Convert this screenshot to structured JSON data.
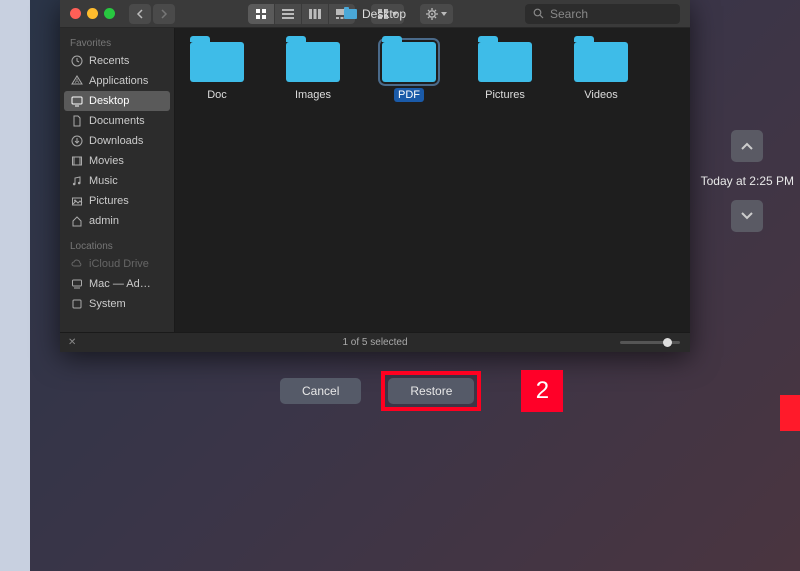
{
  "window": {
    "title": "Desktop"
  },
  "search": {
    "placeholder": "Search"
  },
  "sidebar": {
    "sections": [
      {
        "header": "Favorites",
        "items": [
          {
            "label": "Recents",
            "icon": "clock-icon"
          },
          {
            "label": "Applications",
            "icon": "apps-icon"
          },
          {
            "label": "Desktop",
            "icon": "desktop-icon",
            "selected": true
          },
          {
            "label": "Documents",
            "icon": "documents-icon"
          },
          {
            "label": "Downloads",
            "icon": "downloads-icon"
          },
          {
            "label": "Movies",
            "icon": "movies-icon"
          },
          {
            "label": "Music",
            "icon": "music-icon"
          },
          {
            "label": "Pictures",
            "icon": "pictures-icon"
          },
          {
            "label": "admin",
            "icon": "home-icon"
          }
        ]
      },
      {
        "header": "Locations",
        "items": [
          {
            "label": "iCloud Drive",
            "icon": "icloud-icon",
            "dim": true
          },
          {
            "label": "Mac — Ad…",
            "icon": "mac-icon"
          },
          {
            "label": "System",
            "icon": "disk-icon"
          }
        ]
      }
    ]
  },
  "folders": [
    {
      "label": "Doc"
    },
    {
      "label": "Images"
    },
    {
      "label": "PDF",
      "selected": true
    },
    {
      "label": "Pictures"
    },
    {
      "label": "Videos"
    }
  ],
  "status": {
    "text": "1 of 5 selected"
  },
  "buttons": {
    "cancel": "Cancel",
    "restore": "Restore"
  },
  "annotation": {
    "number": "2"
  },
  "timemachine": {
    "timestamp": "Today at 2:25 PM"
  }
}
